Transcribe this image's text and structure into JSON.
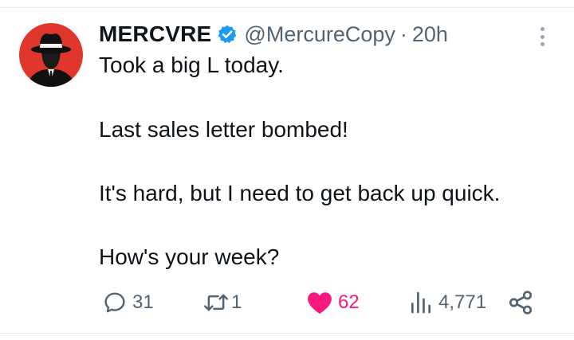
{
  "tweet": {
    "display_name": "MERCVRE",
    "handle": "@MercureCopy",
    "separator": "·",
    "time": "20h",
    "lines": [
      "Took a big L today.",
      "Last sales letter bombed!",
      "It's hard, but I need to get back up quick.",
      "How's your week?"
    ]
  },
  "actions": {
    "replies": "31",
    "reposts": "1",
    "likes": "62",
    "views": "4,771"
  },
  "colors": {
    "avatar_bg": "#e0362c",
    "verified": "#1d9bf0",
    "like": "#f91880",
    "muted": "#536471"
  },
  "icons": [
    "reply-icon",
    "repost-icon",
    "heart-icon",
    "views-icon",
    "share-icon",
    "verified-badge-icon",
    "more-options-icon"
  ]
}
